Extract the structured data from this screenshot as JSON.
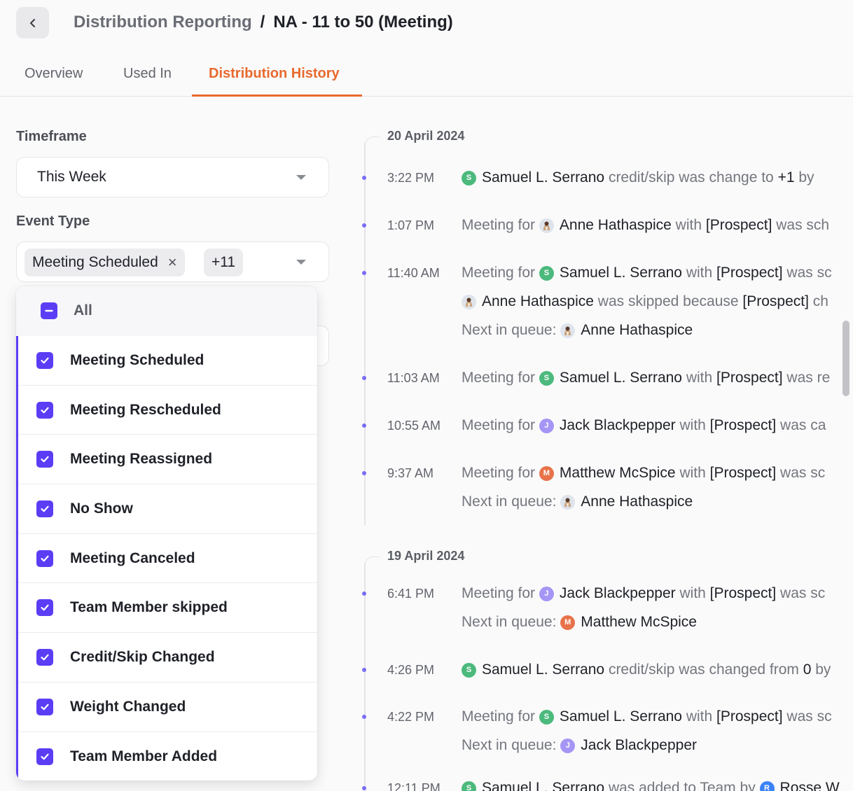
{
  "header": {
    "back_icon": "chevron-left-icon",
    "parent": "Distribution Reporting",
    "separator": "/",
    "current": "NA - 11 to 50 (Meeting)"
  },
  "tabs": [
    {
      "label": "Overview",
      "active": false
    },
    {
      "label": "Used In",
      "active": false
    },
    {
      "label": "Distribution History",
      "active": true
    }
  ],
  "filters": {
    "timeframe_label": "Timeframe",
    "timeframe_value": "This Week",
    "event_type_label": "Event Type",
    "event_chip": "Meeting Scheduled",
    "chip_remove": "×",
    "event_more": "+11"
  },
  "dropdown": {
    "all_label": "All",
    "items": [
      "Meeting Scheduled",
      "Meeting Rescheduled",
      "Meeting Reassigned",
      "No Show",
      "Meeting Canceled",
      "Team Member skipped",
      "Credit/Skip Changed",
      "Weight Changed",
      "Team Member Added"
    ]
  },
  "timeline": {
    "groups": [
      {
        "date": "20 April 2024",
        "events": [
          {
            "time": "3:22 PM",
            "lines": [
              [
                "Samuel L. Serrano",
                " credit/skip was change to ",
                "+1",
                " by "
              ]
            ]
          },
          {
            "time": "1:07 PM",
            "lines": [
              [
                "Meeting for ",
                "Anne Hathaspice",
                " with ",
                "[Prospect]",
                " was sch"
              ]
            ]
          },
          {
            "time": "11:40 AM",
            "lines": [
              [
                "Meeting for ",
                "Samuel L. Serrano",
                " with ",
                "[Prospect]",
                " was sc"
              ],
              [
                "Anne Hathaspice",
                " was skipped because ",
                "[Prospect]",
                " ch"
              ],
              [
                "Next in queue: ",
                "Anne Hathaspice"
              ]
            ]
          },
          {
            "time": "11:03 AM",
            "lines": [
              [
                "Meeting for ",
                "Samuel L. Serrano",
                " with ",
                "[Prospect]",
                " was re"
              ]
            ]
          },
          {
            "time": "10:55 AM",
            "lines": [
              [
                "Meeting for ",
                "Jack Blackpepper",
                " with ",
                "[Prospect]",
                " was ca"
              ]
            ]
          },
          {
            "time": "9:37 AM",
            "lines": [
              [
                "Meeting for ",
                "Matthew McSpice",
                " with ",
                "[Prospect]",
                " was sc"
              ],
              [
                "Next in queue: ",
                "Anne Hathaspice"
              ]
            ]
          }
        ]
      },
      {
        "date": "19 April 2024",
        "events": [
          {
            "time": "6:41 PM",
            "lines": [
              [
                "Meeting for ",
                "Jack Blackpepper",
                " with ",
                "[Prospect]",
                " was sc"
              ],
              [
                "Next in queue: ",
                "Matthew McSpice"
              ]
            ]
          },
          {
            "time": "4:26 PM",
            "lines": [
              [
                "Samuel L. Serrano",
                " credit/skip was changed from ",
                "0",
                " by"
              ]
            ]
          },
          {
            "time": "4:22 PM",
            "lines": [
              [
                "Meeting for ",
                "Samuel L. Serrano",
                " with ",
                "[Prospect]",
                " was sc"
              ],
              [
                "Next in queue: ",
                "Jack Blackpepper"
              ]
            ]
          },
          {
            "time": "12:11 PM",
            "lines": [
              [
                "Samuel L. Serrano",
                " was added to Team by ",
                "Rosse W"
              ]
            ]
          }
        ]
      }
    ]
  },
  "avatars": {
    "Samuel L. Serrano": {
      "initial": "S",
      "color": "#4cb97d"
    },
    "Jack Blackpepper": {
      "initial": "J",
      "color": "#a596f5"
    },
    "Matthew McSpice": {
      "initial": "M",
      "color": "#e8734a"
    },
    "Rosse W": {
      "initial": "R",
      "color": "#3b82f6"
    },
    "Anne Hathaspice": {
      "initial": "",
      "color": "#dfe4ec"
    }
  },
  "colors": {
    "accent": "#e8692e",
    "checkbox": "#5b3df5",
    "timeline_dot": "#7b6cf6"
  }
}
